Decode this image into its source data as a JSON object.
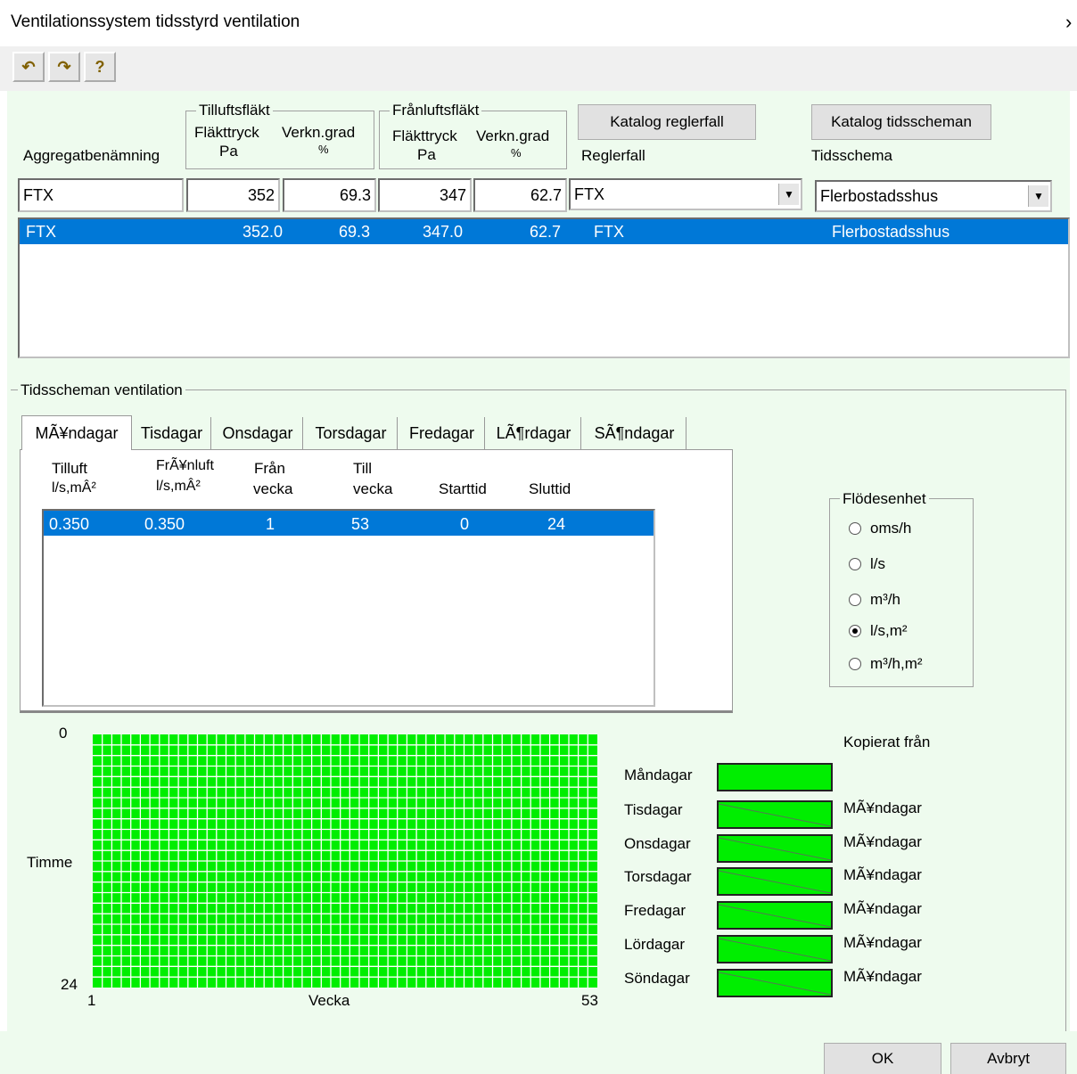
{
  "window": {
    "title": "Ventilationssystem tidsstyrd ventilation",
    "close_glyph": "›"
  },
  "toolbar": {
    "undo_glyph": "↶",
    "redo_glyph": "↷",
    "help_glyph": "?"
  },
  "header": {
    "aggregat_label": "Aggregatbenämning",
    "tilluft_group": "Tilluftsfläkt",
    "franluft_group": "Frånluftsfläkt",
    "fan_pressure": "Fläkttryck",
    "efficiency": "Verkn.grad",
    "unit_pa": "Pa",
    "unit_pct": "%",
    "catalog_control_button": "Katalog reglerfall",
    "catalog_schedule_button": "Katalog tidsscheman",
    "control_label": "Reglerfall",
    "schedule_label": "Tidsschema"
  },
  "inputs": {
    "name": "FTX",
    "supply_pressure": "352",
    "supply_eff": "69.3",
    "exhaust_pressure": "347",
    "exhaust_eff": "62.7",
    "control": "FTX",
    "schedule": "Flerbostadsshus"
  },
  "aggregates": [
    {
      "name": "FTX",
      "supply_pressure": "352.0",
      "supply_eff": "69.3",
      "exhaust_pressure": "347.0",
      "exhaust_eff": "62.7",
      "control": "FTX",
      "schedule": "Flerbostadsshus"
    }
  ],
  "schedule_section": {
    "title": "Tidsscheman ventilation",
    "tabs": [
      "MÃ¥ndagar",
      "Tisdagar",
      "Onsdagar",
      "Torsdagar",
      "Fredagar",
      "LÃ¶rdagar",
      "SÃ¶ndagar"
    ],
    "columns": [
      {
        "l1": "Tilluft",
        "l2": "l/s,mÂ²"
      },
      {
        "l1": "FrÃ¥nluft",
        "l2": "l/s,mÂ²"
      },
      {
        "l1": "Från",
        "l2": "vecka"
      },
      {
        "l1": "Till",
        "l2": "vecka"
      },
      {
        "l1": "",
        "l2": "Starttid"
      },
      {
        "l1": "",
        "l2": "Sluttid"
      }
    ],
    "rows": [
      {
        "tilluft": "0.350",
        "franluft": "0.350",
        "fran": "1",
        "till": "53",
        "start": "0",
        "slut": "24"
      }
    ]
  },
  "flow_unit": {
    "title": "Flödesenhet",
    "options": [
      "oms/h",
      "l/s",
      "m³/h",
      "l/s,m²",
      "m³/h,m²"
    ],
    "selected": 3
  },
  "grid": {
    "y_top": "0",
    "y_bottom": "24",
    "y_label": "Timme",
    "x_left": "1",
    "x_right": "53",
    "x_label": "Vecka",
    "color": "#00ee00"
  },
  "copied": {
    "title": "Kopierat från",
    "days": [
      {
        "day": "Måndagar",
        "from": ""
      },
      {
        "day": "Tisdagar",
        "from": "MÃ¥ndagar"
      },
      {
        "day": "Onsdagar",
        "from": "MÃ¥ndagar"
      },
      {
        "day": "Torsdagar",
        "from": "MÃ¥ndagar"
      },
      {
        "day": "Fredagar",
        "from": "MÃ¥ndagar"
      },
      {
        "day": "Lördagar",
        "from": "MÃ¥ndagar"
      },
      {
        "day": "Söndagar",
        "from": "MÃ¥ndagar"
      }
    ]
  },
  "footer": {
    "ok": "OK",
    "cancel": "Avbryt"
  }
}
